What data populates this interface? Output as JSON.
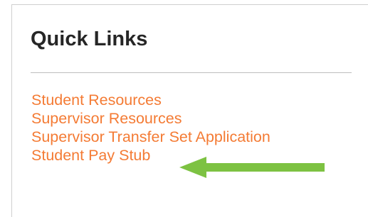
{
  "quick_links": {
    "title": "Quick Links",
    "items": [
      {
        "label": "Student Resources"
      },
      {
        "label": "Supervisor Resources"
      },
      {
        "label": "Supervisor Transfer Set Application"
      },
      {
        "label": "Student Pay Stub"
      }
    ]
  },
  "annotation": {
    "arrow_icon": "left-arrow-icon",
    "arrow_color": "#7dc242",
    "points_to": "Student Pay Stub"
  },
  "colors": {
    "link": "#f47b34",
    "title": "#262626",
    "divider": "#bdbdbd",
    "panel_border": "#cfcfcf"
  }
}
